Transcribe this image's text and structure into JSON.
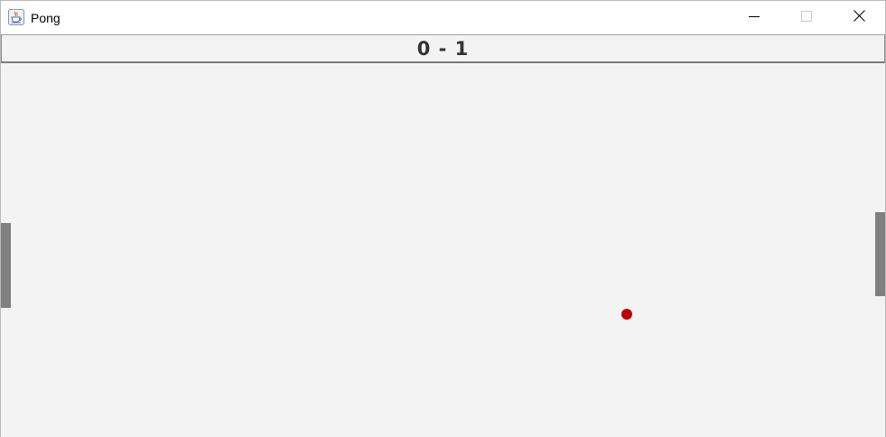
{
  "window": {
    "title": "Pong",
    "app_icon": "java-cup-icon",
    "controls": {
      "minimize": "minimize-icon",
      "maximize": "maximize-icon",
      "close": "close-icon"
    }
  },
  "game": {
    "score_display": "0 - 1",
    "colors": {
      "field": "#f3f3f3",
      "paddle": "#7f7f7f",
      "ball": "#c00000",
      "score_text": "#333333"
    }
  }
}
